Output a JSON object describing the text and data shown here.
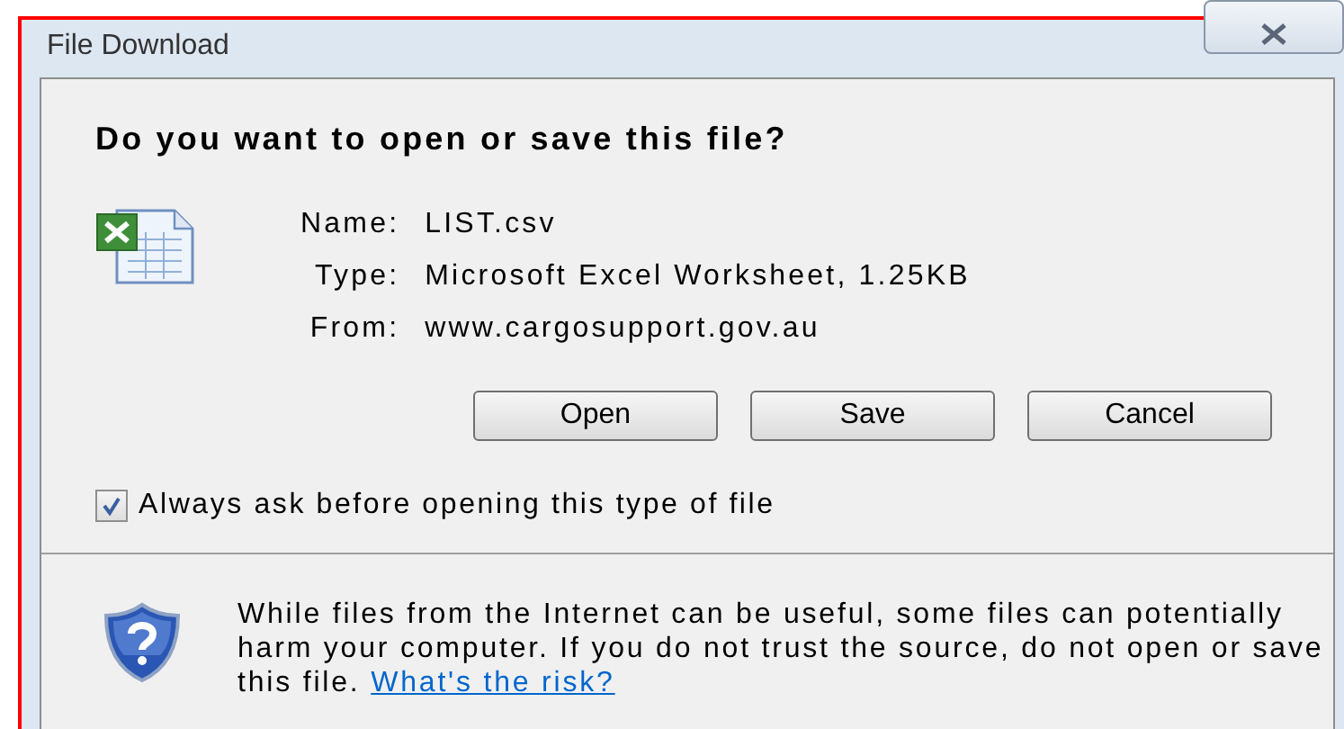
{
  "window": {
    "title": "File Download"
  },
  "question": "Do you want to open or save this file?",
  "file_info": [
    {
      "label": "Name:",
      "value": "LIST.csv"
    },
    {
      "label": "Type:",
      "value": "Microsoft Excel Worksheet, 1.25KB"
    },
    {
      "label": "From:",
      "value": "www.cargosupport.gov.au"
    }
  ],
  "buttons": [
    "Open",
    "Save",
    "Cancel"
  ],
  "always_ask": {
    "label": "Always ask before opening this type of file",
    "checked": true
  },
  "warning": {
    "text": "While files from the Internet can be useful, some files can potentially harm your computer. If you do not trust the source, do not open or save this file.",
    "link": "What's the risk?"
  }
}
